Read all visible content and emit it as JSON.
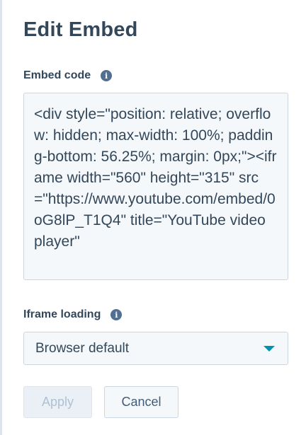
{
  "panel": {
    "title": "Edit Embed"
  },
  "embed_code": {
    "label": "Embed code",
    "info_icon": "info-icon",
    "value": "<div style=\"position: relative; overflow: hidden; max-width: 100%; padding-bottom: 56.25%; margin: 0px;\"><iframe width=\"560\" height=\"315\" src=\"https://www.youtube.com/embed/0oG8lP_T1Q4\" title=\"YouTube video player\""
  },
  "iframe_loading": {
    "label": "Iframe loading",
    "info_icon": "info-icon",
    "selected": "Browser default",
    "caret_icon": "caret-down-icon"
  },
  "actions": {
    "apply_label": "Apply",
    "cancel_label": "Cancel"
  },
  "colors": {
    "text": "#33475b",
    "field_bg": "#f5f8fa",
    "field_border": "#cbd6e2",
    "accent_caret": "#0091ae",
    "disabled_text": "#b0c1d4"
  }
}
